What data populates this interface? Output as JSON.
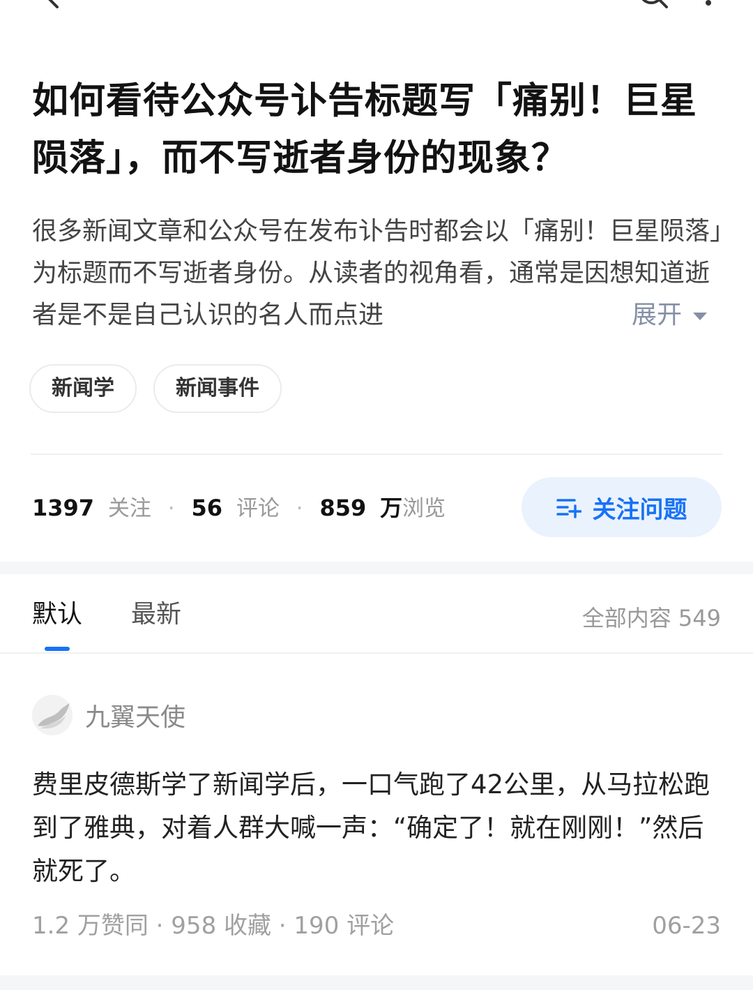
{
  "question": {
    "title": "如何看待公众号讣告标题写「痛别！巨星陨落」，而不写逝者身份的现象？",
    "description": "很多新闻文章和公众号在发布讣告时都会以「痛别！巨星陨落」为标题而不写逝者身份。从读者的视角看，通常是因想知道逝者是不是自己认识的名人而点进",
    "expand_label": "展开",
    "tags": [
      "新闻学",
      "新闻事件"
    ]
  },
  "stats": {
    "followers": "1397",
    "followers_label": "关注",
    "comments": "56",
    "comments_label": "评论",
    "views": "859",
    "views_unit": "万",
    "views_label": "浏览"
  },
  "follow_button": {
    "label": "关注问题"
  },
  "tabs": {
    "default": "默认",
    "latest": "最新",
    "total": "全部内容 549"
  },
  "answer": {
    "author": "九翼天使",
    "content": "费里皮德斯学了新闻学后，一口气跑了42公里，从马拉松跑到了雅典，对着人群大喊一声：“确定了！就在刚刚！”然后就死了。",
    "meta": "1.2 万赞同 · 958 收藏 · 190 评论",
    "date": "06-23"
  },
  "icons": {
    "back": "back-arrow-icon",
    "search": "search-icon",
    "more": "more-icon",
    "follow": "add-list-icon"
  },
  "colors": {
    "accent": "#1772f6",
    "accent_bg": "#eaf2fd"
  }
}
